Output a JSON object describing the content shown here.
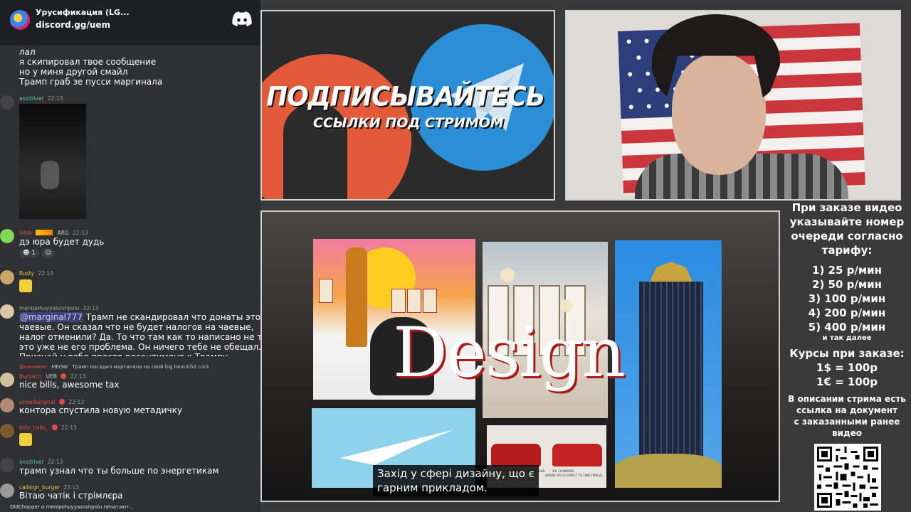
{
  "discord": {
    "server_title": "Урусификация (LG...",
    "invite": "discord.gg/uem"
  },
  "chat": {
    "top_lines": [
      "лал",
      "я скипировал твое сообщение",
      "но у миня другой смайл",
      "Трамп граб зе пусси маргинала"
    ],
    "messages": [
      {
        "author": "assdriver",
        "author_color": "#63c99a",
        "time": "22:13"
      },
      {
        "author": "lshtir",
        "author_color": "#e35050",
        "time": "22:13",
        "tag": "ARG",
        "text": "дэ юра будет дудь",
        "reaction_count": "1"
      },
      {
        "author": "Rusty",
        "author_color": "#e3c94a",
        "time": "22:13"
      },
      {
        "author": "menipohuyyasoshpolu",
        "author_color": "#a6a6a6",
        "time": "22:13",
        "mention": "@marginal777",
        "lines": [
          "Трамп не скандировал что донаты это",
          "чаевые. Он сказал что не будет налогов на чаевые,",
          "налог отменили? Да. То что там как то написано не так",
          "это уже не его проблема. Он ничего тебе не обещал.",
          "Признай у тебя просто ресентимент к Трампу"
        ]
      },
      {
        "author": "@кикимип",
        "author_color": "#e04b4b",
        "tag": "MEOW",
        "reply_text": "Трамп насадил маргинала на свой big beautiful cock"
      },
      {
        "author": "Burbach",
        "author_color": "#e04b4b",
        "time": "22:13",
        "tag": "UEB",
        "text": "nice bills, awesome tax"
      },
      {
        "author": "umerBarginal",
        "author_color": "#e04b4b",
        "time": "22:13",
        "text": "контора спустила новую метадичку"
      },
      {
        "author": "billy_halls_",
        "author_color": "#e04b4b",
        "time": "22:13"
      },
      {
        "author": "assdriver",
        "author_color": "#63c99a",
        "time": "22:13",
        "text": "трамп узнал что ты больше по энергетикам"
      },
      {
        "author": "callsign_burger",
        "author_color": "#e3c94a",
        "time": "22:13",
        "text": "Вітаю чатік і стрімлєра"
      }
    ],
    "typing": "OldChopper и menipohuyyasoshpolu печатают..."
  },
  "promo": {
    "title": "ПОДПИСЫВАЙТЕСЬ",
    "subtitle": "ССЫЛКИ ПОД СТРИМОМ"
  },
  "slide": {
    "word": "Design",
    "caption_line1": "Захід у сфері дизайну, що є",
    "caption_line2": "гарним прикладом.",
    "car_caption_1": "WHERE YOU'D EXPECT TO FIND FOUR.",
    "car_caption_2": "SIX CYLINDERS",
    "car_caption_3": "WHERE YOU'D EXPECT TO FIND TWELVE."
  },
  "info": {
    "header_lines": [
      "При заказе видео",
      "указывайте номер",
      "очереди согласно",
      "тарифу:"
    ],
    "rates": [
      "1) 25 р/мин",
      "2) 50 р/мин",
      "3) 100 р/мин",
      "4) 200 р/мин",
      "5) 400 р/мин"
    ],
    "etc": "и так далее",
    "courses_title": "Курсы при заказе:",
    "course_usd": "1$ = 100р",
    "course_eur": "1€ = 100р",
    "desc_lines": [
      "В описании стрима есть",
      "ссылка на документ",
      "с заказанными ранее",
      "видео"
    ]
  }
}
